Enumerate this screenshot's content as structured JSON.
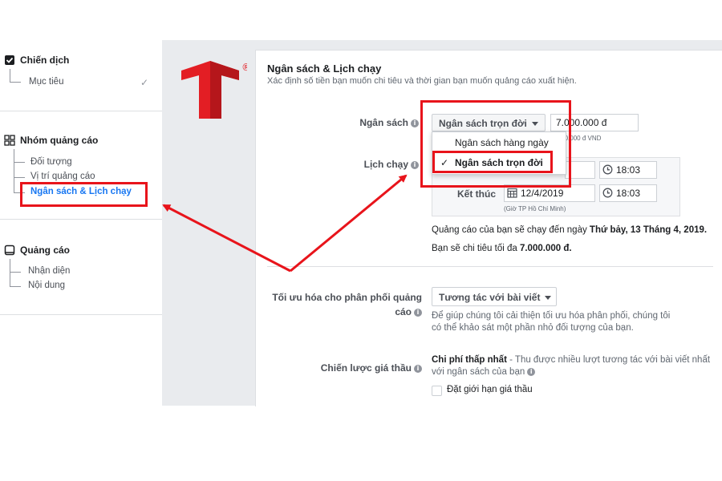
{
  "sidebar": {
    "campaign": {
      "label": "Chiến dịch",
      "children": [
        {
          "label": "Mục tiêu"
        }
      ]
    },
    "adset": {
      "label": "Nhóm quảng cáo",
      "children": [
        {
          "label": "Đối tượng"
        },
        {
          "label": "Vị trí quảng cáo"
        },
        {
          "label": "Ngân sách & Lịch chạy"
        }
      ]
    },
    "ad": {
      "label": "Quảng cáo",
      "children": [
        {
          "label": "Nhận diện"
        },
        {
          "label": "Nội dung"
        }
      ]
    }
  },
  "logo": {
    "registered": "®",
    "color": "#e31e24"
  },
  "section": {
    "title": "Ngân sách & Lịch chạy",
    "subtitle": "Xác định số tiền bạn muốn chi tiêu và thời gian bạn muốn quảng cáo xuất hiện."
  },
  "budget": {
    "label": "Ngân sách",
    "selected": "Ngân sách trọn đời",
    "amount": "7.000.000 đ",
    "currency_note": "7.000.000 đ VND",
    "options": [
      "Ngân sách hàng ngày",
      "Ngân sách trọn đời"
    ],
    "checked_option": "✓"
  },
  "schedule": {
    "label": "Lịch chạy",
    "start_time": "18:03",
    "end_label": "Kết thúc",
    "end_date": "12/4/2019",
    "end_time": "18:03",
    "timezone_note": "(Giờ TP Hồ Chí Minh)",
    "run_until_prefix": "Quảng cáo của bạn sẽ chạy đến ngày ",
    "run_until_date": "Thứ bảy, 13 Tháng 4, 2019.",
    "spend_prefix": "Bạn sẽ chi tiêu tối đa ",
    "spend_amount": "7.000.000 đ."
  },
  "optimization": {
    "label_line1": "Tối ưu hóa cho phân phối quảng",
    "label_line2": "cáo",
    "selected": "Tương tác với bài viết",
    "help_line1": "Để giúp chúng tôi cải thiện tối ưu hóa phân phối, chúng tôi",
    "help_line2": "có thể khảo sát một phần nhỏ đối tượng của bạn."
  },
  "bid": {
    "label": "Chiến lược giá thầu",
    "strategy": "Chi phí thấp nhất",
    "desc_line1": " - Thu được nhiều lượt tương tác với bài viết nhất",
    "desc_line2": "với ngân sách của bạn",
    "cap_label": "Đặt giới hạn giá thầu"
  },
  "colors": {
    "accent": "#1877f2",
    "highlight": "#e8141b",
    "gray_bg": "#e9ebee"
  }
}
